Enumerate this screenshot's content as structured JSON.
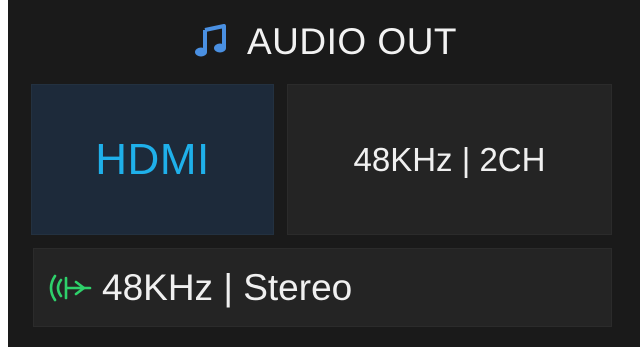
{
  "header": {
    "icon": "music-note-icon",
    "title": "AUDIO OUT"
  },
  "output": {
    "port_label": "HDMI",
    "format_label": "48KHz | 2CH"
  },
  "status": {
    "icon": "audio-signal-icon",
    "label": "48KHz | Stereo"
  },
  "colors": {
    "panel_bg": "#1a1a1a",
    "accent_blue": "#1fb0ea",
    "icon_blue": "#4a90e2",
    "signal_green": "#2ed16b",
    "text_primary": "#f0f0f0"
  }
}
